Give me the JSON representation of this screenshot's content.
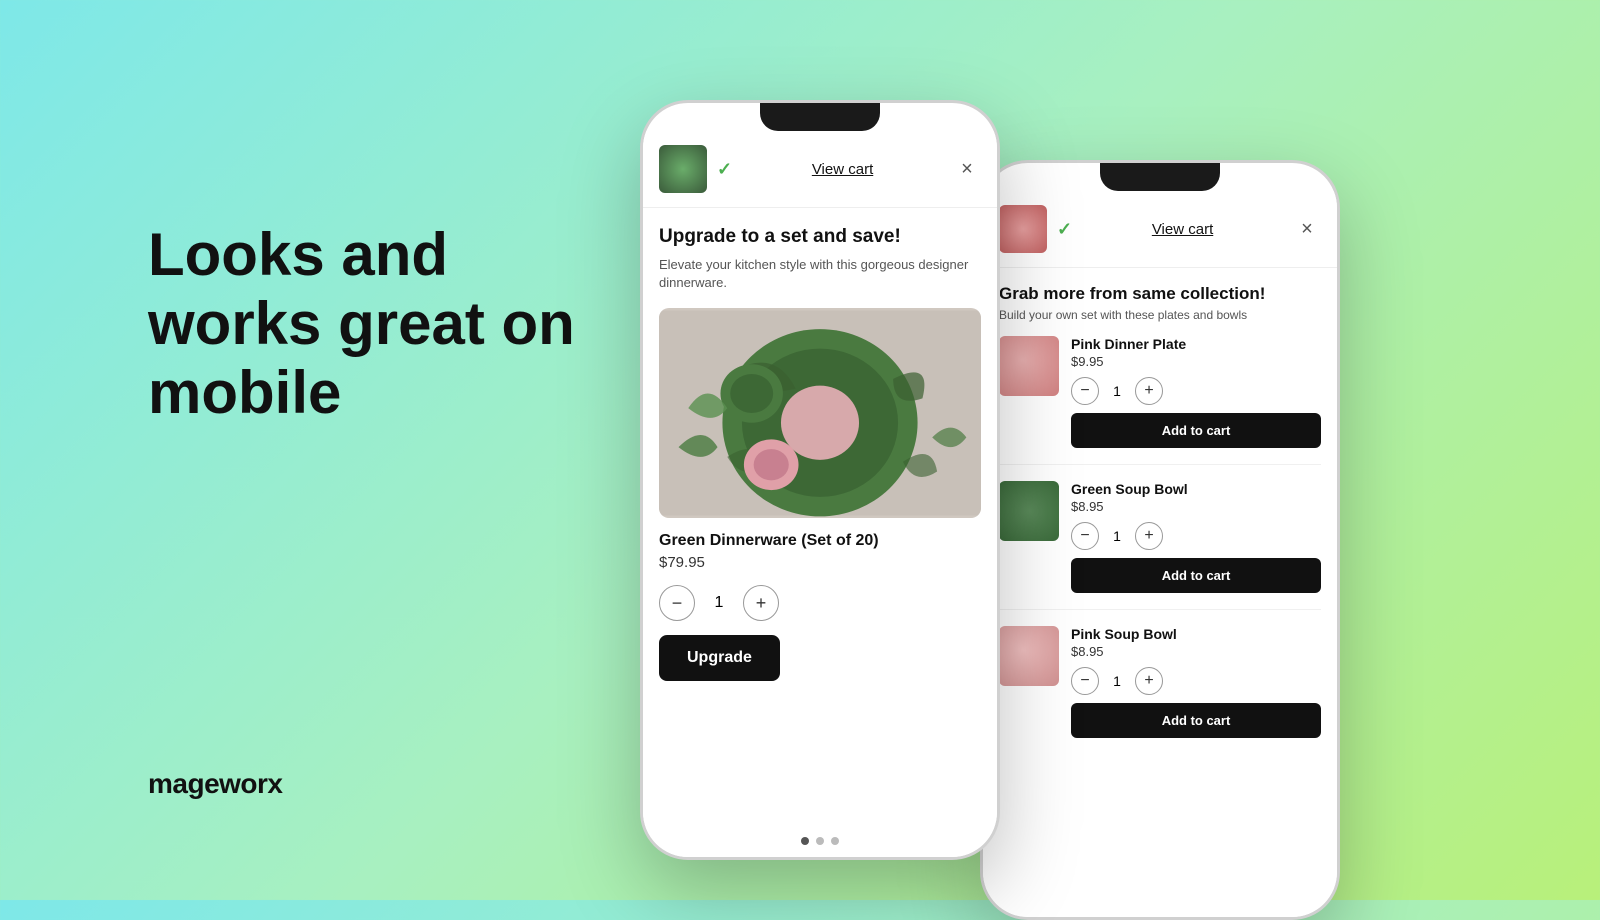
{
  "hero": {
    "title": "Looks and works great on mobile",
    "brand": "mageworx"
  },
  "phone1": {
    "header": {
      "view_cart": "View cart",
      "close": "×"
    },
    "popup": {
      "title": "Upgrade to a set and save!",
      "subtitle": "Elevate your kitchen style with this gorgeous designer dinnerware.",
      "product_name": "Green Dinnerware (Set of 20)",
      "product_price": "$79.95",
      "qty": "1",
      "upgrade_btn": "Upgrade"
    },
    "dots": [
      "active",
      "inactive",
      "inactive"
    ]
  },
  "phone2": {
    "header": {
      "view_cart": "View cart",
      "close": "×"
    },
    "popup": {
      "title": "Grab more from same collection!",
      "subtitle": "Build your own set with these plates and bowls",
      "products": [
        {
          "name": "Pink Dinner Plate",
          "price": "$9.95",
          "qty": "1",
          "add_to_cart": "Add to cart",
          "thumb_type": "pink-plate"
        },
        {
          "name": "Green Soup Bowl",
          "price": "$8.95",
          "qty": "1",
          "add_to_cart": "Add to cart",
          "thumb_type": "green-bowl"
        },
        {
          "name": "Pink Soup Bowl",
          "price": "$8.95",
          "qty": "1",
          "add_to_cart": "Add to cart",
          "thumb_type": "pink-bowl"
        }
      ]
    }
  }
}
